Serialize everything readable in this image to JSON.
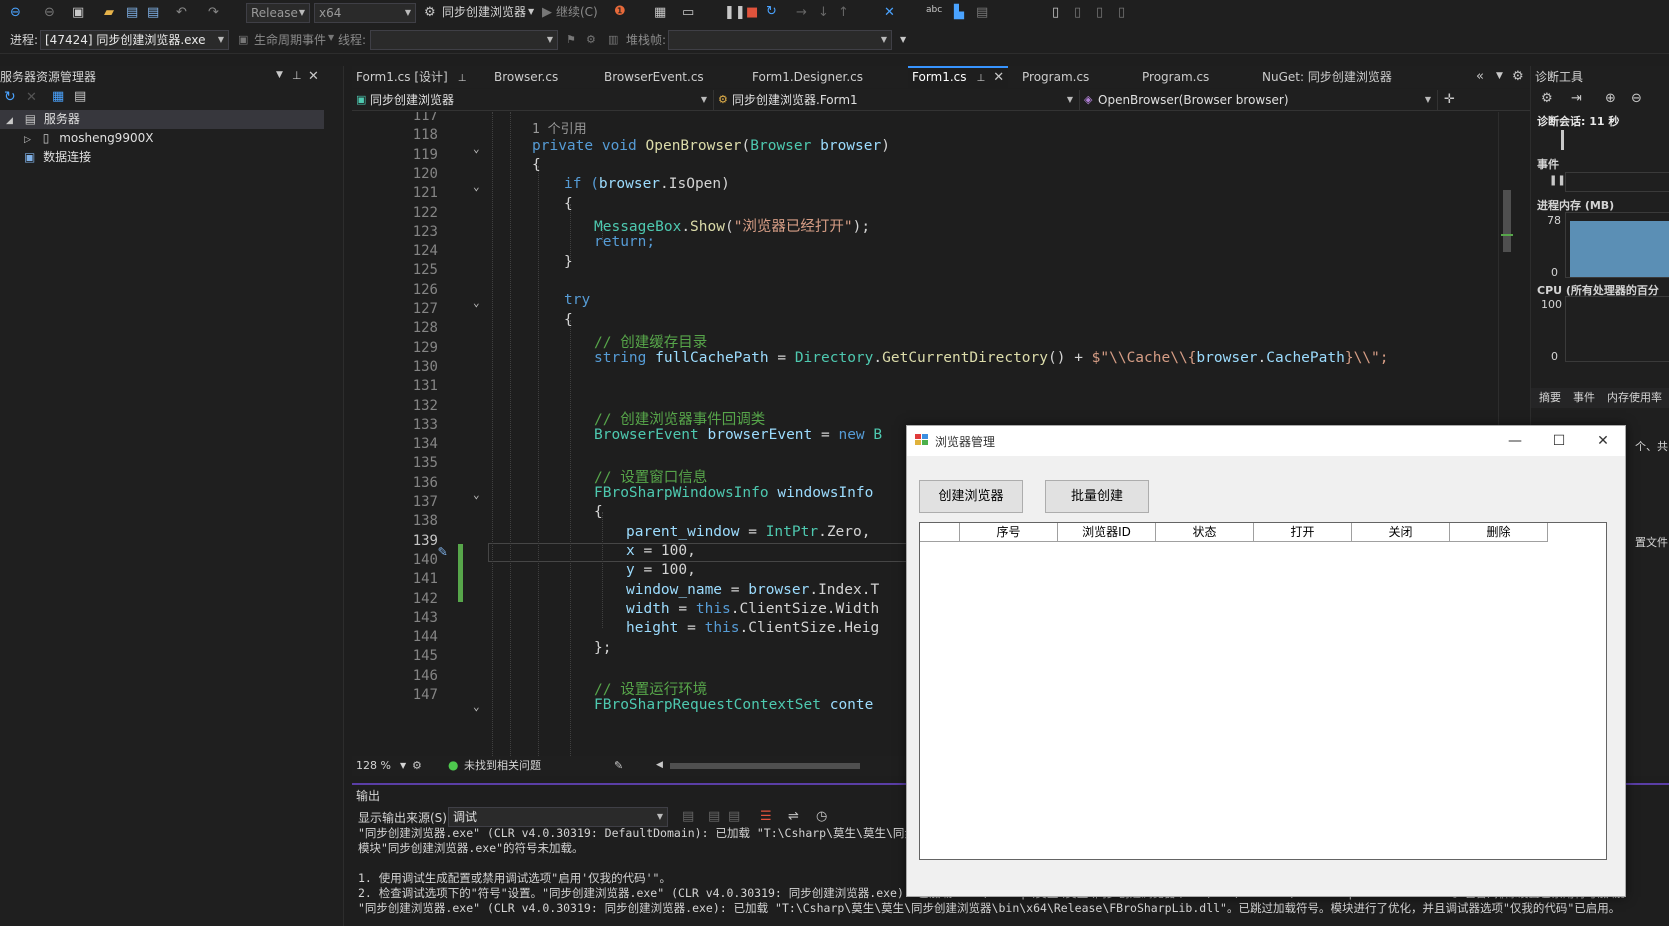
{
  "toolbar": {
    "config": "Release",
    "platform": "x64",
    "start_target": "同步创建浏览器",
    "continue_label": "继续(C)",
    "process_label": "进程:",
    "process_value": "[47424] 同步创建浏览器.exe",
    "lifecycle_label": "生命周期事件",
    "thread_label": "线程:",
    "stackframe_label": "堆栈帧:"
  },
  "server_explorer": {
    "title": "服务器资源管理器",
    "items": [
      {
        "label": "服务器"
      },
      {
        "label": "mosheng9900X"
      },
      {
        "label": "数据连接"
      }
    ]
  },
  "tabs": [
    {
      "label": "Form1.cs [设计]"
    },
    {
      "label": "Browser.cs"
    },
    {
      "label": "BrowserEvent.cs"
    },
    {
      "label": "Form1.Designer.cs"
    },
    {
      "label": "Form1.cs"
    },
    {
      "label": "Program.cs"
    },
    {
      "label": "Program.cs"
    },
    {
      "label": "NuGet: 同步创建浏览器"
    }
  ],
  "navbar": {
    "project": "同步创建浏览器",
    "class": "同步创建浏览器.Form1",
    "member": "OpenBrowser(Browser browser)"
  },
  "editor": {
    "line_numbers": [
      "117",
      "118",
      "119",
      "120",
      "121",
      "122",
      "123",
      "124",
      "125",
      "126",
      "127",
      "128",
      "129",
      "130",
      "131",
      "132",
      "133",
      "134",
      "135",
      "136",
      "137",
      "138",
      "139",
      "140",
      "141",
      "142",
      "143",
      "144",
      "145",
      "146",
      "147"
    ],
    "codelens": "1 个引用",
    "lines": {
      "l118_a": "private void ",
      "l118_fn": "OpenBrowser",
      "l118_b": "(",
      "l118_ty": "Browser",
      "l118_c": " ",
      "l118_vr": "browser",
      "l118_d": ")",
      "l119": "{",
      "l120_a": "if (",
      "l120_vr": "browser",
      "l120_b": ".",
      "l120_c": "IsOpen",
      "l120_d": ")",
      "l121": "{",
      "l122_ty": "MessageBox",
      "l122_a": ".",
      "l122_fn": "Show",
      "l122_b": "(",
      "l122_st": "\"浏览器已经打开\"",
      "l122_c": ");",
      "l123": "return;",
      "l124": "}",
      "l126": "try",
      "l127": "{",
      "l128": "// 创建缓存目录",
      "l129_kw": "string ",
      "l129_vr": "fullCachePath",
      "l129_a": " = ",
      "l129_ty": "Directory",
      "l129_b": ".",
      "l129_fn": "GetCurrentDirectory",
      "l129_c": "() + ",
      "l129_st1": "$\"\\\\Cache\\\\{",
      "l129_vr2": "browser",
      "l129_d": ".",
      "l129_e": "CachePath",
      "l129_st2": "}\\\\\";",
      "l132": "// 创建浏览器事件回调类",
      "l133_ty": "BrowserEvent",
      "l133_vr": " browserEvent",
      "l133_a": " = ",
      "l133_kw": "new ",
      "l133_ty2": "B",
      "l135": "// 设置窗口信息",
      "l136_ty": "FBroSharpWindowsInfo",
      "l136_vr": " windowsInfo",
      "l137": "{",
      "l138_vr": "parent_window",
      "l138_a": " = ",
      "l138_ty": "IntPtr",
      "l138_b": ".Zero,",
      "l139_vr": "x",
      "l139_a": " = 100,",
      "l140_vr": "y",
      "l140_a": " = 100,",
      "l141_vr": "window_name",
      "l141_a": " = ",
      "l141_vr2": "browser",
      "l141_b": ".Index.T",
      "l142_vr": "width",
      "l142_a": " = ",
      "l142_kw": "this",
      "l142_b": ".ClientSize.Width",
      "l143_vr": "height",
      "l143_a": " = ",
      "l143_kw": "this",
      "l143_b": ".ClientSize.Heig",
      "l144": "};",
      "l146": "// 设置运行环境",
      "l147_ty": "FBroSharpRequestContextSet",
      "l147_vr": " conte"
    }
  },
  "editor_status": {
    "zoom": "128 %",
    "issues": "未找到相关问题"
  },
  "output": {
    "title": "输出",
    "source_label": "显示输出来源(S):",
    "source_value": "调试",
    "lines": [
      "\"同步创建浏览器.exe\" (CLR v4.0.30319: DefaultDomain): 已加载 \"T:\\Csharp\\莫生\\莫生\\同步创",
      "模块\"同步创建浏览器.exe\"的符号未加载。",
      "",
      "1. 使用调试生成配置或禁用调试选项\"启用'仅我的代码'\"。",
      "2. 检查调试选项下的\"符号\"设置。\"同步创建浏览器.exe\" (CLR v4.0.30319: 同步创建浏览器.exe): 已加载 \"T:\\Csharp\\莫生\\莫生\\同步创建浏览器\\bin\\x64\\Release\\FBroSharpInterface.dll\"。包含/排除设置已禁用符号加载。",
      "\"同步创建浏览器.exe\" (CLR v4.0.30319: 同步创建浏览器.exe): 已加载 \"T:\\Csharp\\莫生\\莫生\\同步创建浏览器\\bin\\x64\\Release\\FBroSharpLib.dll\"。已跳过加载符号。模块进行了优化，并且调试器选项\"仅我的代码\"已启用。"
    ]
  },
  "diagnostics": {
    "title": "诊断工具",
    "session": "诊断会话: 11 秒",
    "events_label": "事件",
    "memory_label": "进程内存 (MB)",
    "memory_max": "78",
    "memory_min": "0",
    "cpu_label": "CPU (所有处理器的百分",
    "cpu_max": "100",
    "cpu_min": "0",
    "tabs": [
      "摘要",
      "事件",
      "内存使用率"
    ],
    "partial_1": "个、共",
    "partial_2": "置文件"
  },
  "dialog": {
    "title": "浏览器管理",
    "create_button": "创建浏览器",
    "batch_button": "批量创建",
    "columns": [
      "",
      "序号",
      "浏览器ID",
      "状态",
      "打开",
      "关闭",
      "删除"
    ]
  }
}
